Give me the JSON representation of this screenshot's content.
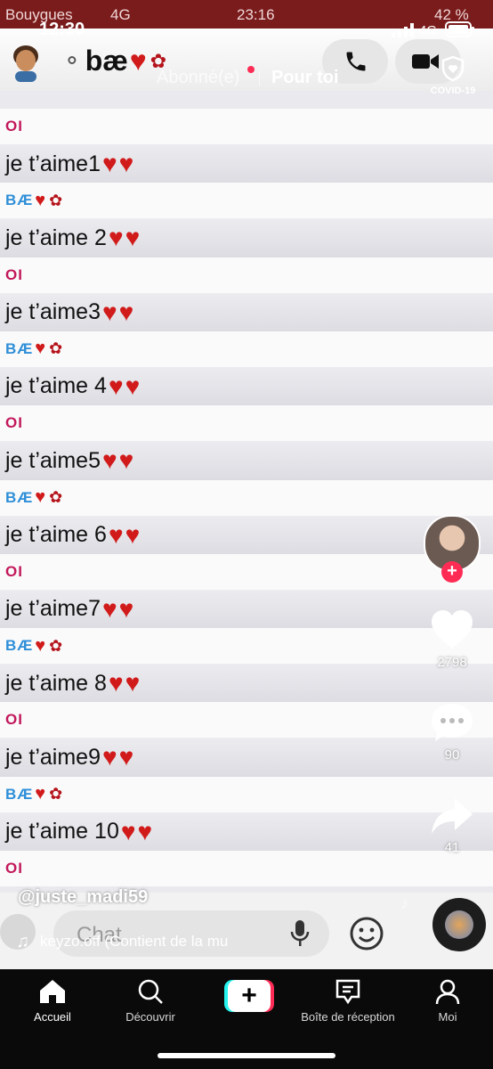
{
  "inner_status": {
    "carrier": "Bouygues",
    "network": "4G",
    "time": "23:16",
    "battery": "42 %"
  },
  "chat_header": {
    "contact_name": "bæ"
  },
  "chat": {
    "messages": [
      {
        "sender": "OI",
        "text": "je t’aime1"
      },
      {
        "sender": "BÆ",
        "text": "je t’aime 2"
      },
      {
        "sender": "OI",
        "text": "je t’aime3"
      },
      {
        "sender": "BÆ",
        "text": "je t’aime 4"
      },
      {
        "sender": "OI",
        "text": "je t’aime5"
      },
      {
        "sender": "BÆ",
        "text": "je t’aime 6"
      },
      {
        "sender": "OI",
        "text": "je t’aime7"
      },
      {
        "sender": "BÆ",
        "text": "je t’aime 8"
      },
      {
        "sender": "OI",
        "text": "je t’aime9"
      },
      {
        "sender": "BÆ",
        "text": "je t’aime 10"
      }
    ],
    "last_sender": "OI",
    "composer_placeholder": "Chat"
  },
  "status_bar": {
    "time": "12:30",
    "network": "4G"
  },
  "top_nav": {
    "following": "Abonné(e)",
    "for_you": "Pour toi",
    "covid": "COVID-19"
  },
  "sidebar": {
    "likes": "2798",
    "comments": "90",
    "shares": "41"
  },
  "video": {
    "username": "@juste_madi59",
    "sound": "keyzo.off (Contient de la mu"
  },
  "bottom_nav": {
    "home": "Accueil",
    "discover": "Découvrir",
    "create": "+",
    "inbox": "Boîte de réception",
    "me": "Moi"
  },
  "colors": {
    "oi_name": "#c2185b",
    "bae_name": "#2f8fd8",
    "heart": "#d11b1b",
    "tt_red": "#fe2c55"
  }
}
